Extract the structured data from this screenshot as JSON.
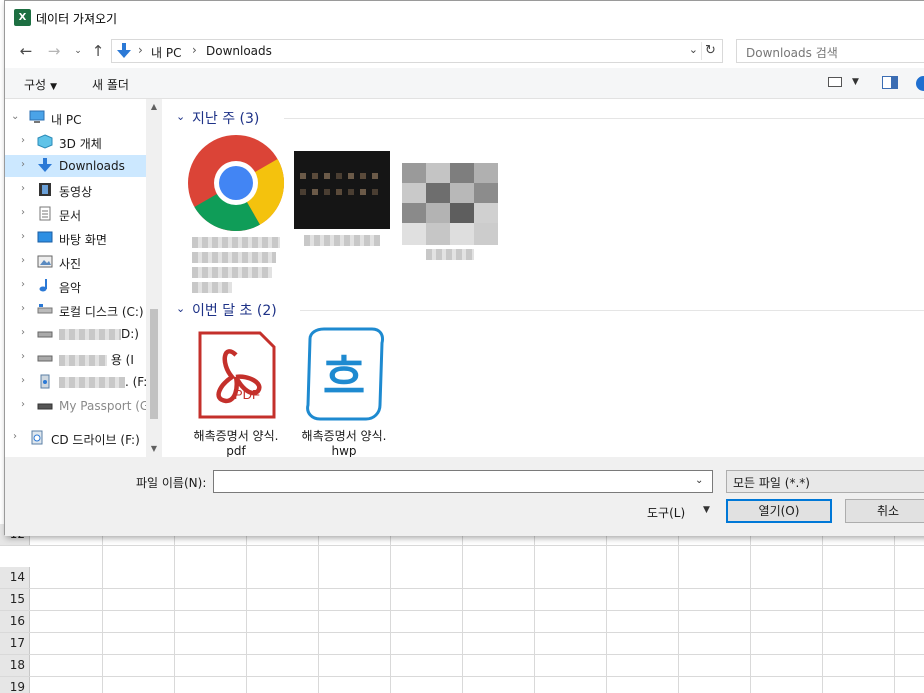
{
  "sheet": {
    "rows": [
      "12",
      "14",
      "15",
      "16",
      "17",
      "18",
      "19"
    ]
  },
  "dialog": {
    "title": "데이터 가져오기",
    "app_icon_letter": "X",
    "address": {
      "crumbs": [
        "내 PC",
        "Downloads"
      ]
    },
    "search_placeholder": "Downloads 검색",
    "toolbar": {
      "organize": "구성",
      "new_folder": "새 폴더"
    },
    "tree": [
      {
        "label": "내 PC",
        "icon": "computer-icon"
      },
      {
        "label": "3D 개체",
        "icon": "cube-icon"
      },
      {
        "label": "Downloads",
        "icon": "download-arrow-icon"
      },
      {
        "label": "동영상",
        "icon": "film-icon"
      },
      {
        "label": "문서",
        "icon": "document-icon"
      },
      {
        "label": "바탕 화면",
        "icon": "desktop-icon"
      },
      {
        "label": "사진",
        "icon": "picture-icon"
      },
      {
        "label": "음악",
        "icon": "music-note-icon"
      },
      {
        "label": "로컬 디스크 (C:)",
        "icon": "local-disk-icon"
      },
      {
        "label": "D:)",
        "icon": "drive-icon"
      },
      {
        "label": "용 (I",
        "icon": "drive-icon"
      },
      {
        "label": ". (F:",
        "icon": "usb-drive-icon"
      },
      {
        "label": "My Passport (G:)",
        "icon": "drive-icon"
      },
      {
        "label": "CD 드라이브 (F:)",
        "icon": "cd-drive-icon"
      }
    ],
    "groups": [
      {
        "title": "지난 주 (3)"
      },
      {
        "title": "이번 달 초 (2)"
      }
    ],
    "files": [
      {
        "name": "해촉증명서 양식.pdf",
        "line1": "해촉증명서 양식.",
        "line2": "pdf",
        "type": "pdf",
        "badge": "PDF"
      },
      {
        "name": "해촉증명서 양식.hwp",
        "line1": "해촉증명서 양식.",
        "line2": "hwp",
        "type": "hwp",
        "badge": "흐"
      }
    ],
    "filename_label": "파일 이름(N):",
    "filename_value": "",
    "filter": "모든 파일 (*.*)",
    "tools": "도구(L)",
    "open": "열기(O)",
    "cancel": "취소"
  }
}
